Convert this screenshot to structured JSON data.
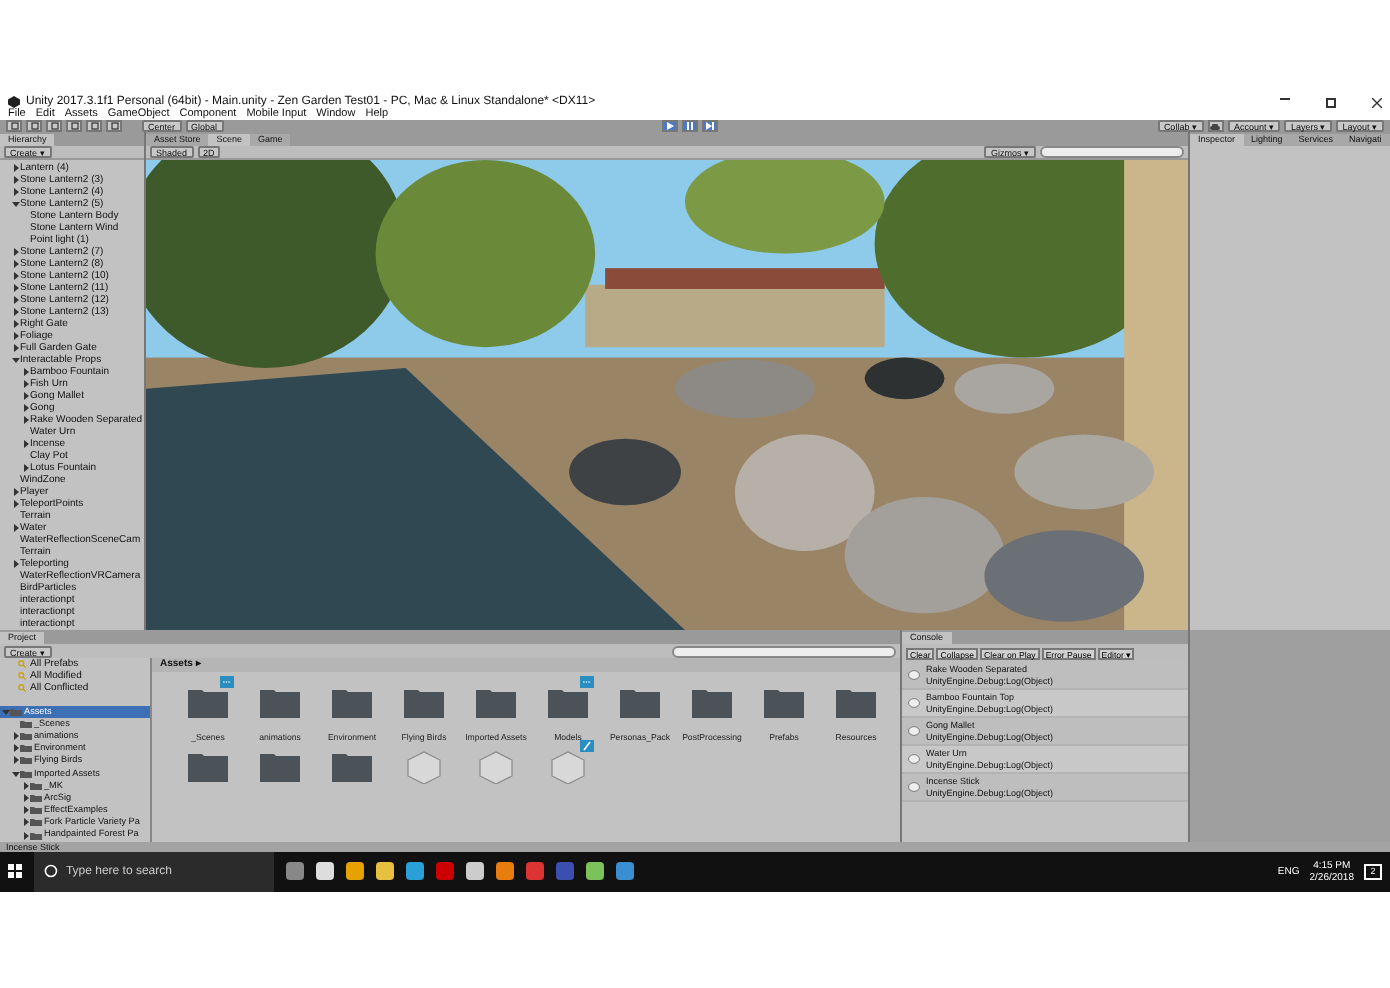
{
  "window": {
    "title": "Unity 2017.3.1f1 Personal (64bit) - Main.unity - Zen Garden Test01 - PC, Mac & Linux Standalone* <DX11>"
  },
  "menu": [
    "File",
    "Edit",
    "Assets",
    "GameObject",
    "Component",
    "Mobile Input",
    "Window",
    "Help"
  ],
  "toolbar": {
    "pivot": "Center",
    "space": "Global",
    "collab": "Collab ▾",
    "account": "Account ▾",
    "layers": "Layers ▾",
    "layout": "Layout ▾"
  },
  "hierarchy": {
    "tab": "Hierarchy",
    "create": "Create ▾",
    "items": [
      {
        "label": "Lantern (4)",
        "expanded": false
      },
      {
        "label": "Stone Lantern2 (3)",
        "expanded": false
      },
      {
        "label": "Stone Lantern2 (4)",
        "expanded": false
      },
      {
        "label": "Stone Lantern2 (5)",
        "expanded": true,
        "children": [
          {
            "label": "Stone Lantern Body"
          },
          {
            "label": "Stone Lantern Wind"
          },
          {
            "label": "Point light (1)"
          }
        ]
      },
      {
        "label": "Stone Lantern2 (7)",
        "expanded": false
      },
      {
        "label": "Stone Lantern2 (8)",
        "expanded": false
      },
      {
        "label": "Stone Lantern2 (10)",
        "expanded": false
      },
      {
        "label": "Stone Lantern2 (11)",
        "expanded": false
      },
      {
        "label": "Stone Lantern2 (12)",
        "expanded": false
      },
      {
        "label": "Stone Lantern2 (13)",
        "expanded": false
      },
      {
        "label": "Right Gate",
        "expanded": false
      },
      {
        "label": "Foliage",
        "expanded": false
      },
      {
        "label": "Full Garden Gate",
        "expanded": false
      },
      {
        "label": "Interactable Props",
        "expanded": true,
        "children": [
          {
            "label": "Bamboo Fountain",
            "expanded": false
          },
          {
            "label": "Fish Urn",
            "expanded": false
          },
          {
            "label": "Gong Mallet",
            "expanded": false
          },
          {
            "label": "Gong",
            "expanded": false
          },
          {
            "label": "Rake Wooden Separated",
            "expanded": false
          },
          {
            "label": "Water Urn"
          },
          {
            "label": "Incense",
            "expanded": false
          },
          {
            "label": "Clay Pot"
          },
          {
            "label": "Lotus Fountain",
            "expanded": false
          }
        ]
      },
      {
        "label": "WindZone"
      },
      {
        "label": "Player",
        "expanded": false
      },
      {
        "label": "TeleportPoints",
        "expanded": false
      },
      {
        "label": "Terrain"
      },
      {
        "label": "Water",
        "expanded": false
      },
      {
        "label": "WaterReflectionSceneCam"
      },
      {
        "label": "Terrain"
      },
      {
        "label": "Teleporting",
        "expanded": false
      },
      {
        "label": "WaterReflectionVRCamera"
      },
      {
        "label": "BirdParticles"
      },
      {
        "label": "interactionpt"
      },
      {
        "label": "interactionpt"
      },
      {
        "label": "interactionpt"
      }
    ]
  },
  "scene": {
    "tabs": [
      {
        "label": "Asset Store",
        "selected": false
      },
      {
        "label": "Scene",
        "selected": true
      },
      {
        "label": "Game",
        "selected": false
      }
    ],
    "shading": "Shaded",
    "mode_2d": "2D",
    "gizmos": "Gizmos ▾"
  },
  "inspector": {
    "tabs": [
      {
        "label": "Inspector",
        "selected": true
      },
      {
        "label": "Lighting",
        "selected": false
      },
      {
        "label": "Services",
        "selected": false
      },
      {
        "label": "Navigati",
        "selected": false
      }
    ]
  },
  "project": {
    "tab": "Project",
    "create": "Create ▾",
    "favorites": [
      "All Prefabs",
      "All Modified",
      "All Conflicted"
    ],
    "tree": [
      {
        "label": "Assets",
        "expanded": true,
        "selected": true,
        "children": [
          {
            "label": "_Scenes"
          },
          {
            "label": "animations",
            "expanded": false
          },
          {
            "label": "Environment",
            "expanded": false
          },
          {
            "label": "Flying Birds",
            "expanded": false
          },
          {
            "label": "Imported Assets",
            "expanded": true,
            "children": [
              {
                "label": "_MK",
                "expanded": false
              },
              {
                "label": "ArcSig",
                "expanded": false
              },
              {
                "label": "EffectExamples",
                "expanded": false
              },
              {
                "label": "Fork Particle Variety Pa",
                "expanded": false
              },
              {
                "label": "Handpainted Forest Pa",
                "expanded": false
              }
            ]
          }
        ]
      }
    ],
    "breadcrumb": "Assets ▸",
    "assets": [
      {
        "kind": "folder",
        "label": "_Scenes",
        "collab": true,
        "edited": false
      },
      {
        "kind": "folder",
        "label": "animations",
        "collab": false,
        "edited": false
      },
      {
        "kind": "folder",
        "label": "Environment",
        "collab": false,
        "edited": false
      },
      {
        "kind": "folder",
        "label": "Flying Birds",
        "collab": false,
        "edited": false
      },
      {
        "kind": "folder",
        "label": "Imported Assets",
        "collab": false,
        "edited": false
      },
      {
        "kind": "folder",
        "label": "Models",
        "collab": true,
        "edited": false
      },
      {
        "kind": "folder",
        "label": "Personas_Pack",
        "collab": false,
        "edited": false
      },
      {
        "kind": "folder",
        "label": "PostProcessing",
        "collab": false,
        "edited": false
      },
      {
        "kind": "folder",
        "label": "Prefabs",
        "collab": false,
        "edited": false
      },
      {
        "kind": "folder",
        "label": "Resources",
        "collab": false,
        "edited": false
      },
      {
        "kind": "folder",
        "collab": false,
        "edited": false
      },
      {
        "kind": "folder",
        "collab": false,
        "edited": false
      },
      {
        "kind": "folder",
        "collab": false,
        "edited": false
      },
      {
        "kind": "prefab",
        "collab": false,
        "edited": false
      },
      {
        "kind": "prefab",
        "collab": false,
        "edited": false
      },
      {
        "kind": "prefab",
        "collab": false,
        "edited": true
      }
    ]
  },
  "console": {
    "tab": "Console",
    "buttons": [
      "Clear",
      "Collapse",
      "Clear on Play",
      "Error Pause",
      "Editor ▾"
    ],
    "entries": [
      {
        "message": "Rake Wooden Separated",
        "source": "UnityEngine.Debug:Log(Object)"
      },
      {
        "message": "Bamboo Fountain Top",
        "source": "UnityEngine.Debug:Log(Object)"
      },
      {
        "message": "Gong Mallet",
        "source": "UnityEngine.Debug:Log(Object)"
      },
      {
        "message": "Water Urn",
        "source": "UnityEngine.Debug:Log(Object)"
      },
      {
        "message": "Incense Stick",
        "source": "UnityEngine.Debug:Log(Object)"
      }
    ]
  },
  "status_bar": "Incense Stick",
  "taskbar": {
    "search_placeholder": "Type here to search",
    "language": "ENG",
    "time": "4:15 PM",
    "date": "2/26/2018",
    "notifications": "2"
  }
}
